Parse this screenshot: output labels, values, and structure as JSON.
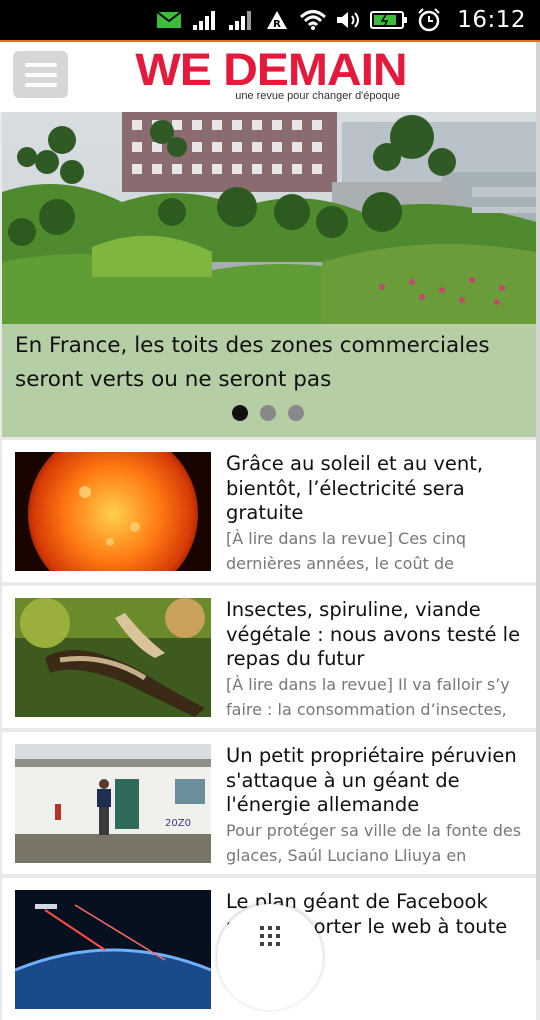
{
  "status_bar": {
    "time": "16:12",
    "icons": [
      "mail-icon",
      "signal-icon",
      "signal-icon-2",
      "roaming-icon",
      "wifi-icon",
      "volume-icon",
      "battery-icon",
      "alarm-icon"
    ]
  },
  "header": {
    "logo_title": "WE DEMAIN",
    "logo_tagline": "une revue pour changer d'époque",
    "menu_icon": "hamburger-menu-icon",
    "brand_color": "#e5193c"
  },
  "hero": {
    "title": "En France, les toits des zones commerciales seront verts ou ne seront pas",
    "slide_count": 3,
    "active_slide": 1
  },
  "articles": [
    {
      "title": "Grâce au soleil et au vent, bientôt, l’électricité sera gratuite",
      "excerpt": "[À lire dans la revue] Ces cinq dernières années, le coût de"
    },
    {
      "title": "Insectes, spiruline, viande végétale : nous avons testé le repas du futur",
      "excerpt": "[À lire dans la revue] Il va falloir s’y faire : la consommation d’insectes,"
    },
    {
      "title": "Un petit propriétaire péruvien s'attaque à un géant de l'énergie allemande",
      "excerpt": "Pour protéger sa ville de la fonte des glaces, Saúl Luciano Lliuya en"
    },
    {
      "title": "Le plan géant de Facebook pour apporter le web à toute la",
      "excerpt": ""
    }
  ],
  "bottom_button_icon": "grid-menu-icon"
}
